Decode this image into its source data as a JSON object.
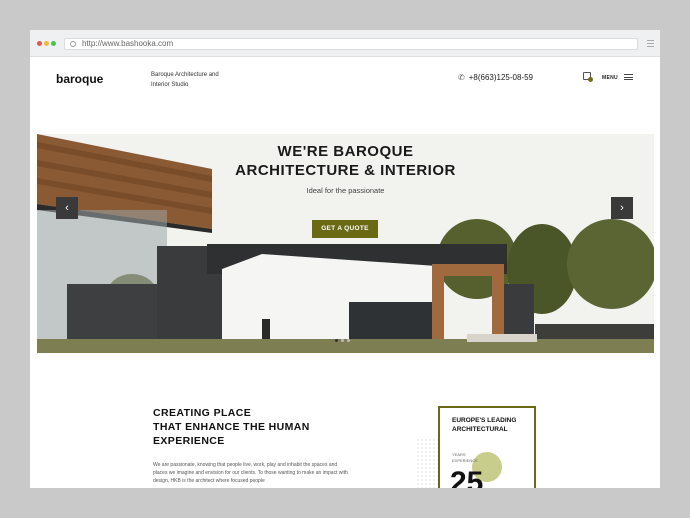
{
  "browser": {
    "url": "http://www.bashooka.com"
  },
  "header": {
    "logo": "baroque",
    "tagline_line1": "Baroque Architecture and",
    "tagline_line2": "Interior Studio",
    "phone": "+8(663)125-08-59",
    "menu_label": "MENU"
  },
  "hero": {
    "title_line1": "WE'RE BAROQUE",
    "title_line2": "ARCHITECTURE & INTERIOR",
    "subtitle": "Ideal for the passionate",
    "cta_label": "GET A QUOTE",
    "prev_label": "‹",
    "next_label": "›",
    "active_slide": 1,
    "slide_count": 3
  },
  "about": {
    "title_line1": "CREATING PLACE",
    "title_line2": "THAT ENHANCE THE HUMAN",
    "title_line3": "EXPERIENCE",
    "text": "We are passionate, knowing that people live, work, play and inhabit the spaces and places we imagine and envision for our clients. To those wanting to make an impact with design, HKB is the architect where focused people"
  },
  "award": {
    "title_line1": "EUROPE'S LEADING",
    "title_line2": "ARCHITECTURAL",
    "small_line1": "YEARS",
    "small_line2": "EXPERIENCE",
    "number": "25"
  },
  "colors": {
    "accent": "#6a6a14",
    "dark": "#1a1a1a"
  }
}
